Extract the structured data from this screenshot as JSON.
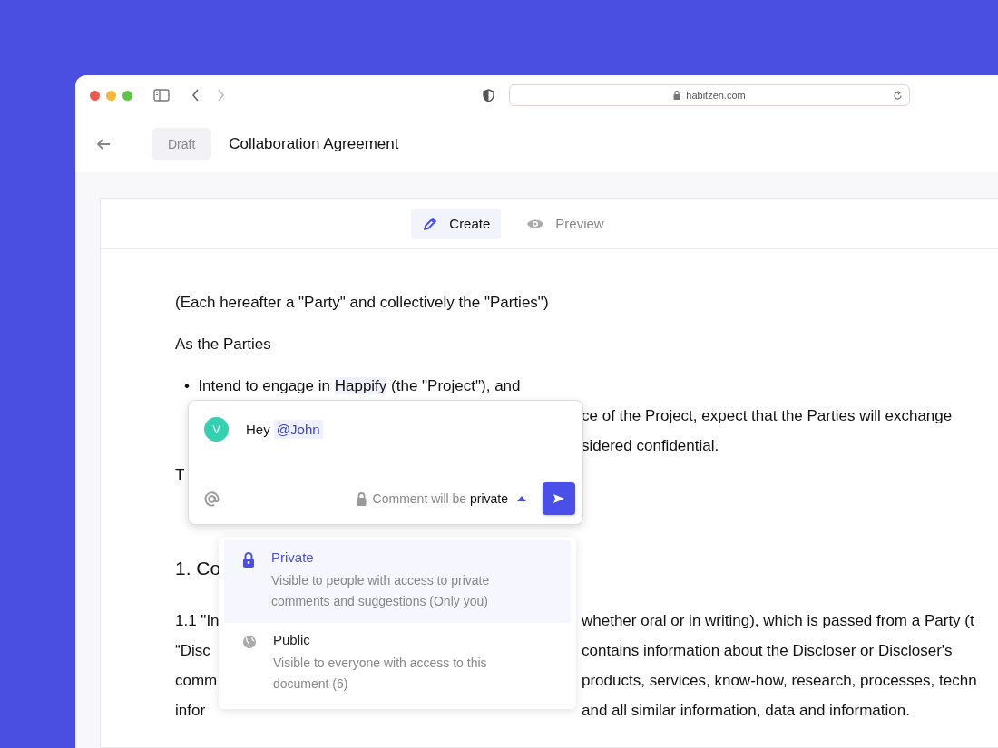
{
  "browser": {
    "url": "habitzen.com"
  },
  "header": {
    "status": "Draft",
    "title": "Collaboration Agreement"
  },
  "tabs": [
    {
      "label": "Create",
      "selected": true
    },
    {
      "label": "Preview",
      "selected": false
    }
  ],
  "document": [
    {
      "kind": "paragraph",
      "left": "(Each hereafter a \"Party\" and collectively the \"Parties\")"
    },
    {
      "kind": "paragraph",
      "left": "As the Parties"
    },
    {
      "kind": "bullet",
      "bullet": "•",
      "before": "Intend to engage in ",
      "highlight": "Happify",
      "after": " (the \"Project\"), and"
    },
    {
      "kind": "line",
      "right": "ce of the Project, expect that the Parties will exchange"
    },
    {
      "kind": "line",
      "right": "sidered confidential."
    },
    {
      "kind": "paragraph",
      "left": "T"
    },
    {
      "kind": "heading",
      "left": "1. Co"
    },
    {
      "kind": "line",
      "left": "1.1 \"In",
      "right": "whether oral or in writing), which is passed from a Party (t"
    },
    {
      "kind": "line",
      "left": "“Disc",
      "right": "contains information about the Discloser or Discloser's"
    },
    {
      "kind": "line",
      "left": "comm",
      "right": "products, services, know-how, research, processes, techn"
    },
    {
      "kind": "line",
      "left": "infor",
      "right": "and all similar information, data and information."
    }
  ],
  "comment": {
    "avatar": "V",
    "text": "Hey",
    "mention": "@John",
    "privacy_label": "Comment will be",
    "privacy_value": "private",
    "menu_open": true
  },
  "privacy_options": [
    {
      "label": "Private",
      "description": "Visible to people with access to private comments and suggestions (Only you)",
      "selected": true
    },
    {
      "label": "Public",
      "description": "Visible to everyone with access to this document (6)",
      "selected": false
    }
  ]
}
